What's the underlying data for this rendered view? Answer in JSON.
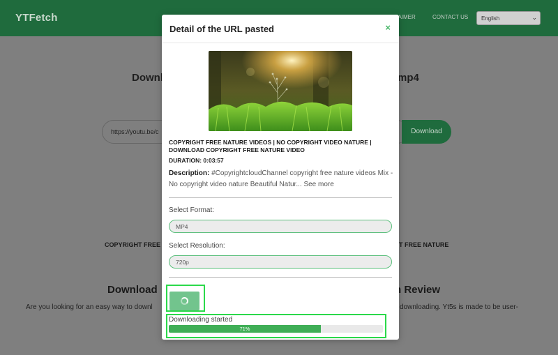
{
  "site": {
    "logo": "YTFetch",
    "language": "English"
  },
  "nav": {
    "disclaimer": "LAIMER",
    "contact": "CONTACT US"
  },
  "background": {
    "heading_left": "Downlo",
    "heading_right": "mp4",
    "url_input_value": "https://youtu.be/c",
    "download_button": "Download",
    "caption_left": "COPYRIGHT FREE",
    "caption_right": "T FREE NATURE",
    "subhead_left": "Download",
    "subhead_right": "h Review",
    "para_left": "Are you looking for an easy way to downl",
    "para_right": "downloading. Yt5s is made to be user-"
  },
  "modal": {
    "title": "Detail of the URL pasted",
    "close_icon": "×",
    "video_title": "COPYRIGHT FREE NATURE VIDEOS | NO COPYRIGHT VIDEO NATURE | DOWNLOAD COPYRIGHT FREE NATURE VIDEO",
    "duration": "DURATION: 0:03:57",
    "description_label": "Description:",
    "description_text": " #CopyrightcloudChannel copyright free nature videos Mix - No copyright video nature Beautiful Natur...",
    "see_more": " See more",
    "format_label": "Select Format:",
    "format_value": "MP4",
    "resolution_label": "Select Resolution:",
    "resolution_value": "720p",
    "download_status": "Downloading started",
    "progress": 71,
    "progress_text": "71%"
  },
  "colors": {
    "brand_green": "#1f6b3d",
    "accent_green": "#46b667",
    "progress_green": "#3fae56",
    "highlight": "#2bd94a"
  }
}
